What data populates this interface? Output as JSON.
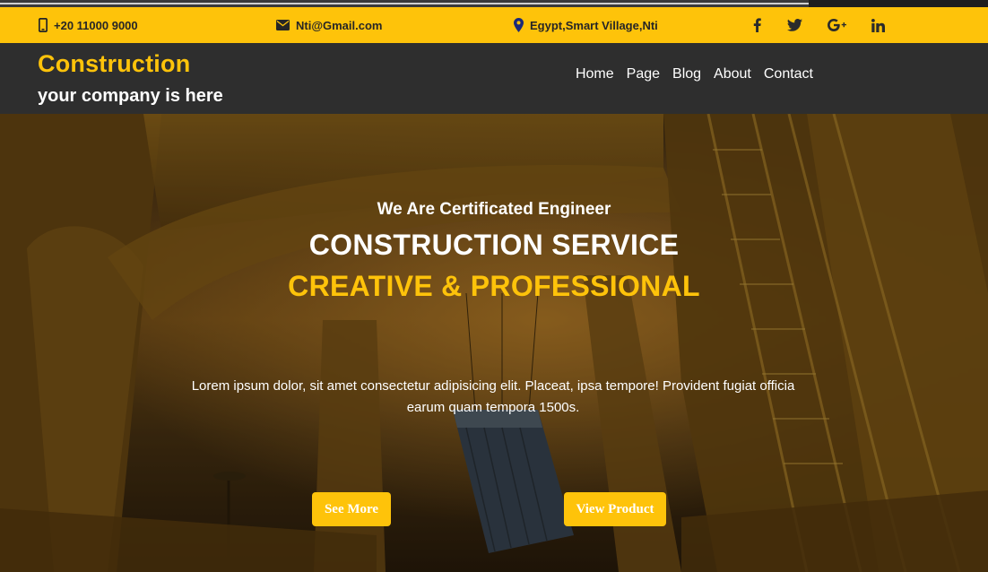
{
  "topbar": {
    "phone": "+20 11000 9000",
    "email": "Nti@Gmail.com",
    "location": "Egypt,Smart Village,Nti",
    "social": [
      "facebook-icon",
      "twitter-icon",
      "google-plus-icon",
      "linkedin-icon"
    ]
  },
  "header": {
    "brand": "Construction",
    "tagline": "your company is here"
  },
  "nav": {
    "items": [
      "Home",
      "Page",
      "Blog",
      "About",
      "Contact"
    ]
  },
  "hero": {
    "subtitle": "We Are Certificated Engineer",
    "title": "CONSTRUCTION SERVICE",
    "title_accent": "CREATIVE & PROFESSIONAL",
    "description": "Lorem ipsum dolor, sit amet consectetur adipisicing elit. Placeat, ipsa tempore! Provident fugiat officia earum quam tempora 1500s.",
    "button_primary": "See More",
    "button_secondary": "View Product"
  },
  "colors": {
    "accent": "#fec30a",
    "navbar": "#2e2e2e",
    "text_light": "#ffffff"
  }
}
